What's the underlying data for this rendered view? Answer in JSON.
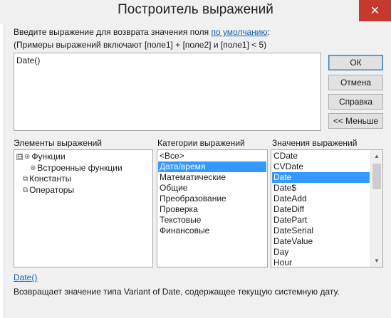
{
  "window": {
    "title": "Построитель выражений",
    "close_icon": "✕"
  },
  "prompt": {
    "line1_before": "Введите выражение для возврата значения поля ",
    "line1_link": "по умолчанию",
    "line1_after": ":",
    "line2": "(Примеры выражений включают [поле1] + [поле2] и [поле1] < 5)"
  },
  "expression": {
    "value": "Date()"
  },
  "buttons": {
    "ok": "ОК",
    "cancel": "Отмена",
    "help": "Справка",
    "less": "<< Меньше"
  },
  "elements_pane": {
    "label": "Элементы выражений",
    "items": [
      {
        "label": "Функции",
        "expander": "⊟",
        "icon": "folder-open-icon",
        "glyph": "⊛"
      },
      {
        "label": "Встроенные функции",
        "expander": "",
        "icon": "function-icon",
        "glyph": "⊛"
      },
      {
        "label": "Константы",
        "expander": "",
        "icon": "constants-icon",
        "glyph": "⧉"
      },
      {
        "label": "Операторы",
        "expander": "",
        "icon": "operators-icon",
        "glyph": "⧉"
      }
    ]
  },
  "categories_pane": {
    "label": "Категории выражений",
    "items": [
      "<Все>",
      "Дата/время",
      "Математические",
      "Общие",
      "Преобразование",
      "Проверка",
      "Текстовые",
      "Финансовые"
    ],
    "selected": "Дата/время"
  },
  "values_pane": {
    "label": "Значения выражений",
    "items": [
      "CDate",
      "CVDate",
      "Date",
      "Date$",
      "DateAdd",
      "DateDiff",
      "DatePart",
      "DateSerial",
      "DateValue",
      "Day",
      "Hour"
    ],
    "selected": "Date",
    "scroll": {
      "up_icon": "▲",
      "down_icon": "▼"
    }
  },
  "description": {
    "link": "Date()",
    "text": "Возвращает значение типа Variant of Date, содержащее текущую системную дату."
  }
}
